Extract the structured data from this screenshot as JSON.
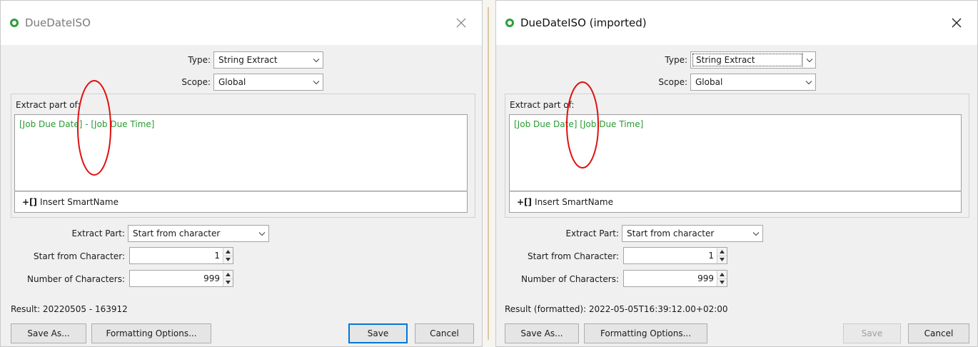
{
  "left_dialog": {
    "title": "DueDateISO",
    "type_label": "Type:",
    "type_value": "String Extract",
    "scope_label": "Scope:",
    "scope_value": "Global",
    "extract_group_title": "Extract part of:",
    "extract_text": "[Job Due Date] - [Job Due Time]",
    "insert_label": "Insert SmartName",
    "insert_icon": "+[]",
    "extract_part_label": "Extract Part:",
    "extract_part_value": "Start from character",
    "start_label": "Start from Character:",
    "start_value": "1",
    "count_label": "Number of Characters:",
    "count_value": "999",
    "result_text": "Result: 20220505 - 163912",
    "save_as_label": "Save As...",
    "formatting_label": "Formatting Options...",
    "save_label": "Save",
    "cancel_label": "Cancel"
  },
  "right_dialog": {
    "title": "DueDateISO (imported)",
    "type_label": "Type:",
    "type_value": "String Extract",
    "scope_label": "Scope:",
    "scope_value": "Global",
    "extract_group_title": "Extract part of:",
    "extract_text": "[Job Due Date] [Job Due Time]",
    "insert_label": "Insert SmartName",
    "insert_icon": "+[]",
    "extract_part_label": "Extract Part:",
    "extract_part_value": "Start from character",
    "start_label": "Start from Character:",
    "start_value": "1",
    "count_label": "Number of Characters:",
    "count_value": "999",
    "result_text": "Result (formatted): 2022-05-05T16:39:12.00+02:00",
    "save_as_label": "Save As...",
    "formatting_label": "Formatting Options...",
    "save_label": "Save",
    "cancel_label": "Cancel"
  },
  "colors": {
    "smartname_green": "#2a9a33",
    "annotation_red": "#e01010",
    "primary_blue": "#0078d7",
    "app_icon_green": "#2e9e3d"
  }
}
